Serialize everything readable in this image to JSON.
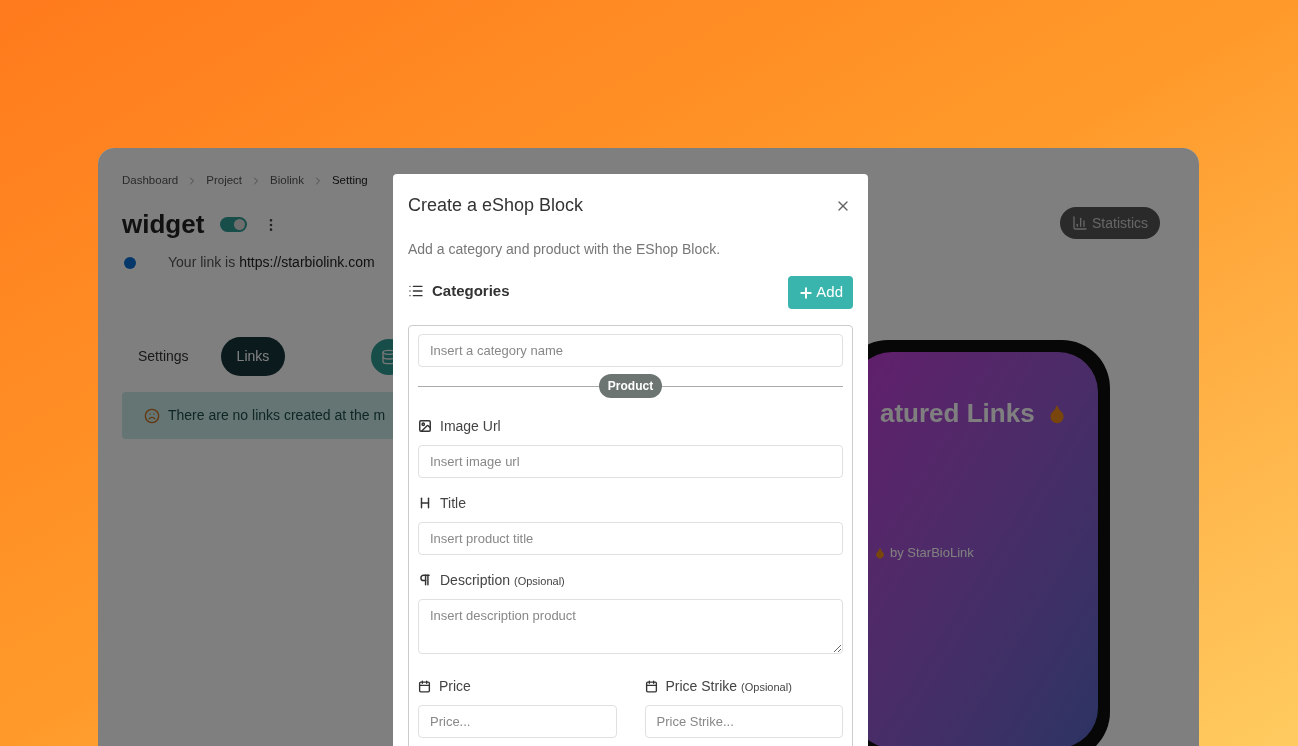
{
  "breadcrumb": [
    "Dashboard",
    "Project",
    "Biolink",
    "Setting"
  ],
  "page": {
    "title": "widget",
    "toggle": {
      "on": true
    },
    "link_prefix": "Your link is",
    "link_url": "https://starbiolink.com"
  },
  "tabs": [
    {
      "label": "Settings",
      "selected": false
    },
    {
      "label": "Links",
      "selected": true
    }
  ],
  "alert": "There are no links created at the m",
  "statistics_button": "Statistics",
  "phone": {
    "heading": "atured Links",
    "footer": "by StarBioLink"
  },
  "modal": {
    "title": "Create a eShop Block",
    "subtitle": "Add a category and product with the EShop Block.",
    "categories_label": "Categories",
    "add_button": "Add",
    "category_placeholder": "Insert a category name",
    "divider_label": "Product",
    "fields": [
      {
        "kind": "input",
        "label": "Image Url",
        "placeholder": "Insert image url"
      },
      {
        "kind": "input",
        "label": "Title",
        "placeholder": "Insert product title"
      },
      {
        "kind": "textarea",
        "label": "Description",
        "note": "(Opsional)",
        "placeholder": "Insert description product"
      }
    ],
    "price_fields": [
      {
        "label": "Price",
        "placeholder": "Price..."
      },
      {
        "label": "Price Strike",
        "note": "(Opsional)",
        "placeholder": "Price Strike..."
      }
    ]
  }
}
